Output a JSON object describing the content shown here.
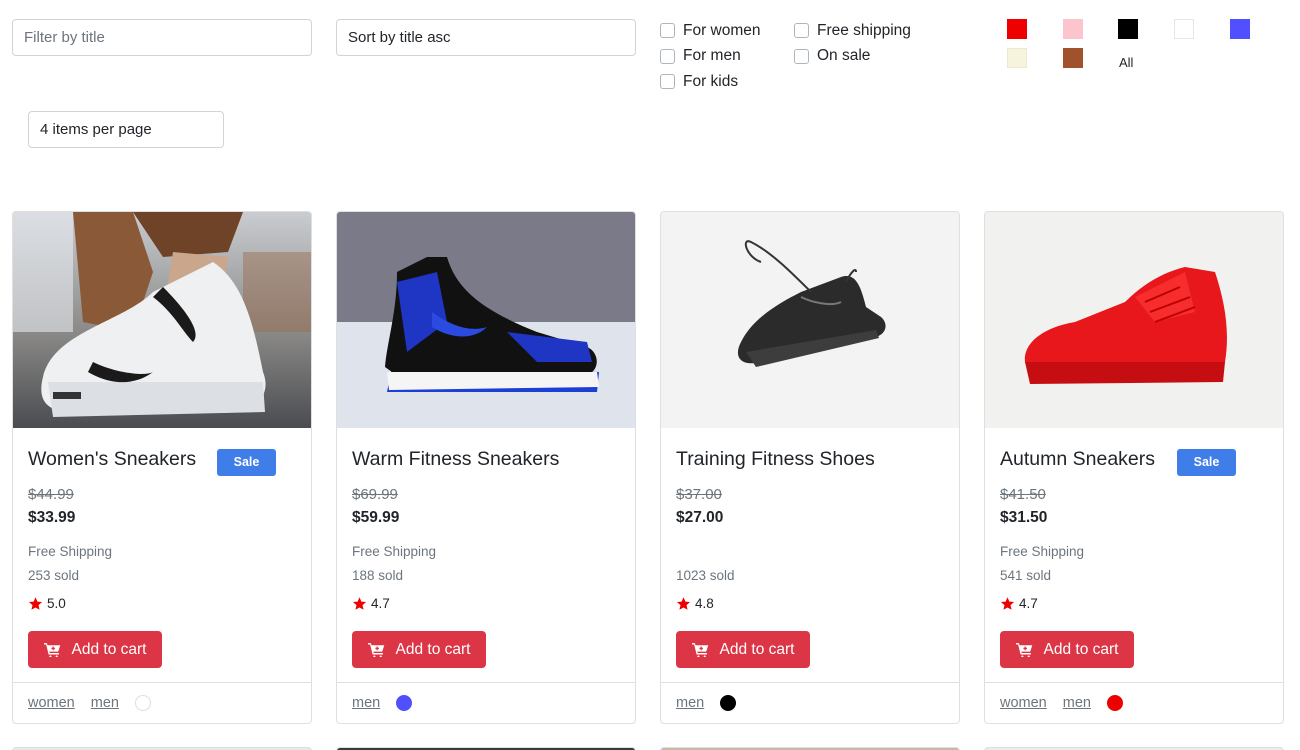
{
  "filters": {
    "title_filter": {
      "value": "",
      "placeholder": "Filter by title"
    },
    "sort": {
      "selected": "Sort by title asc"
    },
    "per_page": {
      "selected": "4 items per page"
    },
    "checkboxes": [
      {
        "label": "For women",
        "checked": false
      },
      {
        "label": "For men",
        "checked": false
      },
      {
        "label": "For kids",
        "checked": false
      },
      {
        "label": "Free shipping",
        "checked": false
      },
      {
        "label": "On sale",
        "checked": false
      }
    ],
    "colors": [
      {
        "name": "red",
        "hex": "#ee0000"
      },
      {
        "name": "pink",
        "hex": "#fcc4cc"
      },
      {
        "name": "black",
        "hex": "#000000"
      },
      {
        "name": "white",
        "hex": "#ffffff"
      },
      {
        "name": "blue",
        "hex": "#5050ff"
      },
      {
        "name": "beige",
        "hex": "#f6f4dc"
      },
      {
        "name": "brown",
        "hex": "#a0522d"
      }
    ],
    "colors_all_label": "All"
  },
  "products": [
    {
      "title": "Women's Sneakers",
      "on_sale": true,
      "sale_label": "Sale",
      "old_price": "$44.99",
      "price": "$33.99",
      "shipping": "Free Shipping",
      "sold": "253 sold",
      "rating": "5.0",
      "cart_label": "Add to cart",
      "tags": [
        "women",
        "men"
      ],
      "color": "#ffffff",
      "image": "white-sneaker"
    },
    {
      "title": "Warm Fitness Sneakers",
      "on_sale": false,
      "sale_label": "",
      "old_price": "$69.99",
      "price": "$59.99",
      "shipping": "Free Shipping",
      "sold": "188 sold",
      "rating": "4.7",
      "cart_label": "Add to cart",
      "tags": [
        "men"
      ],
      "color": "#5050ff",
      "image": "blue-high-top"
    },
    {
      "title": "Training Fitness Shoes",
      "on_sale": false,
      "sale_label": "",
      "old_price": "$37.00",
      "price": "$27.00",
      "shipping": "",
      "sold": "1023 sold",
      "rating": "4.8",
      "cart_label": "Add to cart",
      "tags": [
        "men"
      ],
      "color": "#000000",
      "image": "black-trainer"
    },
    {
      "title": "Autumn Sneakers",
      "on_sale": true,
      "sale_label": "Sale",
      "old_price": "$41.50",
      "price": "$31.50",
      "shipping": "Free Shipping",
      "sold": "541 sold",
      "rating": "4.7",
      "cart_label": "Add to cart",
      "tags": [
        "women",
        "men"
      ],
      "color": "#ee0000",
      "image": "red-sneaker"
    }
  ]
}
